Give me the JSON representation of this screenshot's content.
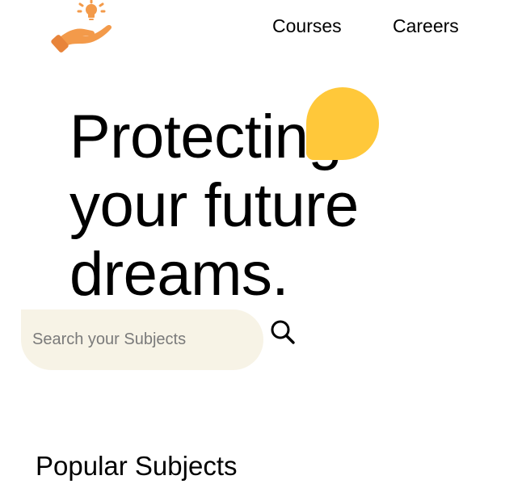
{
  "header": {
    "logo_icon": "hand-lightbulb-icon",
    "brand_color": "#f39a4a",
    "nav": [
      {
        "label": "Courses"
      },
      {
        "label": "Careers"
      }
    ]
  },
  "hero": {
    "title_lines": [
      "Protecting",
      "your future",
      "dreams."
    ],
    "blob_color": "#ffc83a"
  },
  "search": {
    "placeholder": "Search your Subjects",
    "value": "",
    "icon": "search-icon",
    "field_color": "#f7f3e6"
  },
  "popular": {
    "heading": "Popular Subjects"
  }
}
